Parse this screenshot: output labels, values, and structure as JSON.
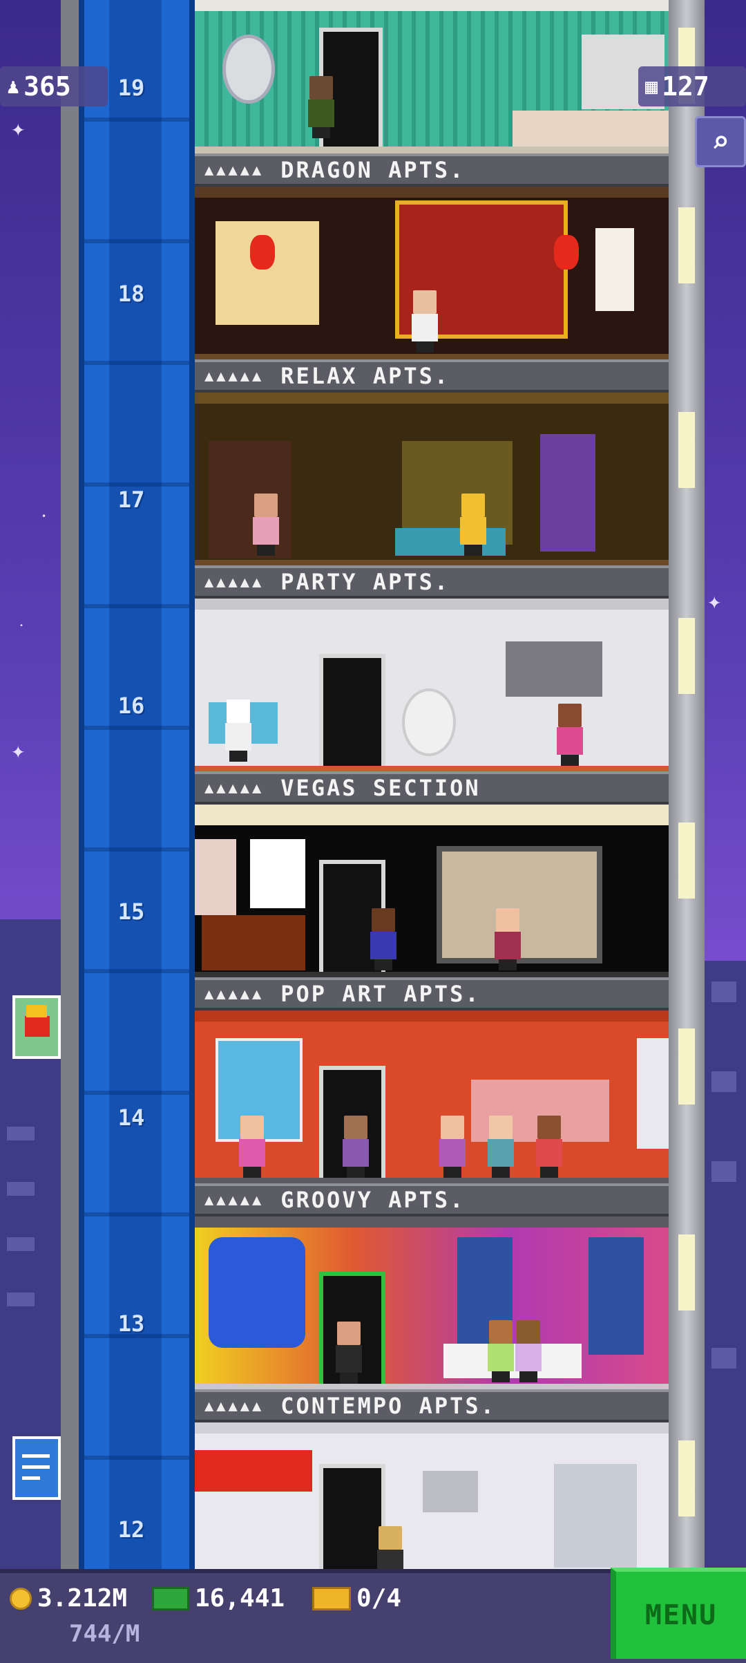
{
  "hud": {
    "population": "365",
    "floors_count": "127",
    "coins": "3.212M",
    "income": "744/M",
    "bux": "16,441",
    "tickets": "0/4",
    "menu_label": "MENU"
  },
  "floors": [
    {
      "number": "19",
      "next_label": "DRAGON APTS.",
      "rating": "▲▲▲▲▲"
    },
    {
      "number": "18",
      "next_label": "RELAX APTS.",
      "rating": "▲▲▲▲▲"
    },
    {
      "number": "17",
      "next_label": "PARTY APTS.",
      "rating": "▲▲▲▲▲"
    },
    {
      "number": "16",
      "next_label": "VEGAS SECTION",
      "rating": "▲▲▲▲▲"
    },
    {
      "number": "15",
      "next_label": "POP ART APTS.",
      "rating": "▲▲▲▲▲"
    },
    {
      "number": "14",
      "next_label": "GROOVY APTS.",
      "rating": "▲▲▲▲▲"
    },
    {
      "number": "13",
      "next_label": "CONTEMPO APTS.",
      "rating": "▲▲▲▲▲"
    },
    {
      "number": "12"
    }
  ],
  "icons": {
    "population": "person-icon",
    "floors": "building-icon",
    "search": "magnifier-icon",
    "coin": "coin-icon",
    "bux": "bux-icon",
    "ticket": "ticket-icon"
  },
  "colors": {
    "sky": "#5a3fb5",
    "elevator": "#1f67d0",
    "menu_button": "#1fc23a",
    "hud_bar": "#45406e"
  }
}
